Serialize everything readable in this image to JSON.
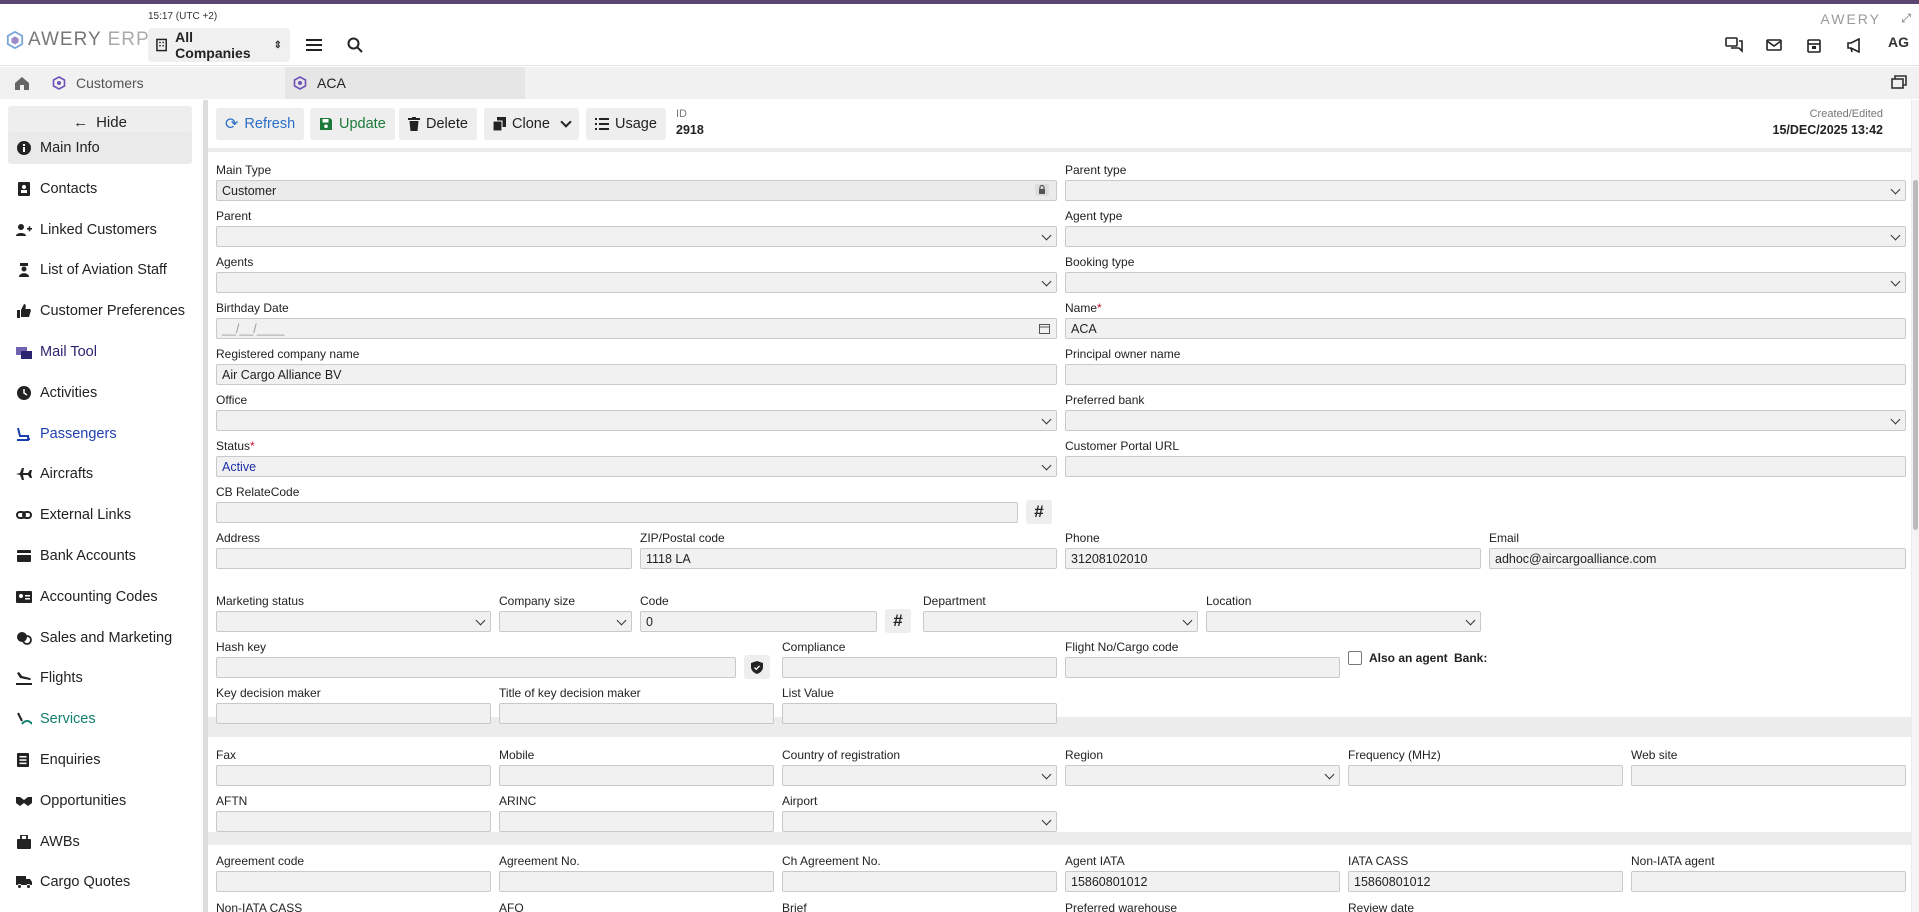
{
  "header": {
    "clock": "15:17 (UTC +2)",
    "logo_main": "AWERY",
    "logo_sub": "ERP",
    "company_select": "All Companies",
    "brand": "AWERY",
    "avatar": "AG"
  },
  "tabs": {
    "customers": "Customers",
    "current": "ACA"
  },
  "sidebar": {
    "hide": "Hide",
    "items": [
      {
        "label": "Main Info",
        "icon": "info-icon",
        "color": "#222222"
      },
      {
        "label": "Contacts",
        "icon": "contacts-icon",
        "color": "#222222"
      },
      {
        "label": "Linked Customers",
        "icon": "user-plus-icon",
        "color": "#222222"
      },
      {
        "label": "List of Aviation Staff",
        "icon": "pilot-icon",
        "color": "#222222"
      },
      {
        "label": "Customer Preferences",
        "icon": "thumbs-up-icon",
        "color": "#222222"
      },
      {
        "label": "Mail Tool",
        "icon": "mail-tool-icon",
        "color": "#2b2570"
      },
      {
        "label": "Activities",
        "icon": "clock-icon",
        "color": "#222222"
      },
      {
        "label": "Passengers",
        "icon": "seat-icon",
        "color": "#1c3fb0"
      },
      {
        "label": "Aircrafts",
        "icon": "plane-icon",
        "color": "#222222"
      },
      {
        "label": "External Links",
        "icon": "link-icon",
        "color": "#222222"
      },
      {
        "label": "Bank Accounts",
        "icon": "bank-icon",
        "color": "#222222"
      },
      {
        "label": "Accounting Codes",
        "icon": "id-card-icon",
        "color": "#222222"
      },
      {
        "label": "Sales and Marketing",
        "icon": "sales-icon",
        "color": "#222222"
      },
      {
        "label": "Flights",
        "icon": "plane-landing-icon",
        "color": "#222222"
      },
      {
        "label": "Services",
        "icon": "services-icon",
        "color": "#12806e"
      },
      {
        "label": "Enquiries",
        "icon": "list-icon",
        "color": "#222222"
      },
      {
        "label": "Opportunities",
        "icon": "handshake-icon",
        "color": "#222222"
      },
      {
        "label": "AWBs",
        "icon": "bag-icon",
        "color": "#222222"
      },
      {
        "label": "Cargo Quotes",
        "icon": "truck-icon",
        "color": "#222222"
      }
    ]
  },
  "toolbar": {
    "refresh": "Refresh",
    "update": "Update",
    "delete": "Delete",
    "clone": "Clone",
    "usage": "Usage",
    "id_label": "ID",
    "id_value": "2918",
    "created_label": "Created/Edited",
    "created_value": "15/DEC/2025 13:42"
  },
  "form": {
    "main_type": {
      "label": "Main Type",
      "value": "Customer"
    },
    "parent_type": {
      "label": "Parent type",
      "value": ""
    },
    "parent": {
      "label": "Parent",
      "value": ""
    },
    "agent_type": {
      "label": "Agent type",
      "value": ""
    },
    "agents": {
      "label": "Agents",
      "value": ""
    },
    "booking_type": {
      "label": "Booking type",
      "value": ""
    },
    "birthday": {
      "label": "Birthday Date",
      "placeholder": "__/__/____"
    },
    "name": {
      "label": "Name",
      "value": "ACA",
      "required": "*"
    },
    "registered_name": {
      "label": "Registered company name",
      "value": "Air Cargo Alliance BV"
    },
    "principal_owner": {
      "label": "Principal owner name",
      "value": ""
    },
    "office": {
      "label": "Office",
      "value": ""
    },
    "preferred_bank": {
      "label": "Preferred bank",
      "value": ""
    },
    "status": {
      "label": "Status",
      "value": "Active",
      "required": "*"
    },
    "portal_url": {
      "label": "Customer Portal URL",
      "value": ""
    },
    "cb_relate": {
      "label": "CB RelateCode",
      "value": ""
    },
    "address": {
      "label": "Address",
      "value": ""
    },
    "zip": {
      "label": "ZIP/Postal code",
      "value": "1118 LA"
    },
    "phone": {
      "label": "Phone",
      "value": "31208102010"
    },
    "email": {
      "label": "Email",
      "value": "adhoc@aircargoalliance.com"
    }
  },
  "marketing": {
    "marketing_status": {
      "label": "Marketing status",
      "value": ""
    },
    "company_size": {
      "label": "Company size",
      "value": ""
    },
    "code": {
      "label": "Code",
      "value": "0"
    },
    "department": {
      "label": "Department",
      "value": ""
    },
    "location": {
      "label": "Location",
      "value": ""
    },
    "hash_key": {
      "label": "Hash key",
      "value": ""
    },
    "compliance": {
      "label": "Compliance",
      "value": ""
    },
    "flight_no": {
      "label": "Flight No/Cargo code",
      "value": ""
    },
    "also_agent": "Also an agent",
    "bank": "Bank:",
    "key_decision_maker": {
      "label": "Key decision maker",
      "value": ""
    },
    "title_kdm": {
      "label": "Title of key decision maker",
      "value": ""
    },
    "list_value": {
      "label": "List Value",
      "value": ""
    }
  },
  "contact": {
    "fax": {
      "label": "Fax",
      "value": ""
    },
    "mobile": {
      "label": "Mobile",
      "value": ""
    },
    "country": {
      "label": "Country of registration",
      "value": ""
    },
    "region": {
      "label": "Region",
      "value": ""
    },
    "frequency": {
      "label": "Frequency (MHz)",
      "value": ""
    },
    "website": {
      "label": "Web site",
      "value": ""
    },
    "aftn": {
      "label": "AFTN",
      "value": ""
    },
    "arinc": {
      "label": "ARINC",
      "value": ""
    },
    "airport": {
      "label": "Airport",
      "value": ""
    }
  },
  "agreement": {
    "agreement_code": {
      "label": "Agreement code",
      "value": ""
    },
    "agreement_no": {
      "label": "Agreement No.",
      "value": ""
    },
    "ch_agreement_no": {
      "label": "Ch Agreement No.",
      "value": ""
    },
    "agent_iata": {
      "label": "Agent IATA",
      "value": "15860801012"
    },
    "iata_cass": {
      "label": "IATA CASS",
      "value": "15860801012"
    },
    "non_iata_agent": {
      "label": "Non-IATA agent",
      "value": ""
    },
    "non_iata_cass": {
      "label": "Non-IATA CASS"
    },
    "afo": {
      "label": "AFO"
    },
    "brief": {
      "label": "Brief"
    },
    "preferred_warehouse": {
      "label": "Preferred warehouse"
    },
    "review_date": {
      "label": "Review date"
    }
  }
}
